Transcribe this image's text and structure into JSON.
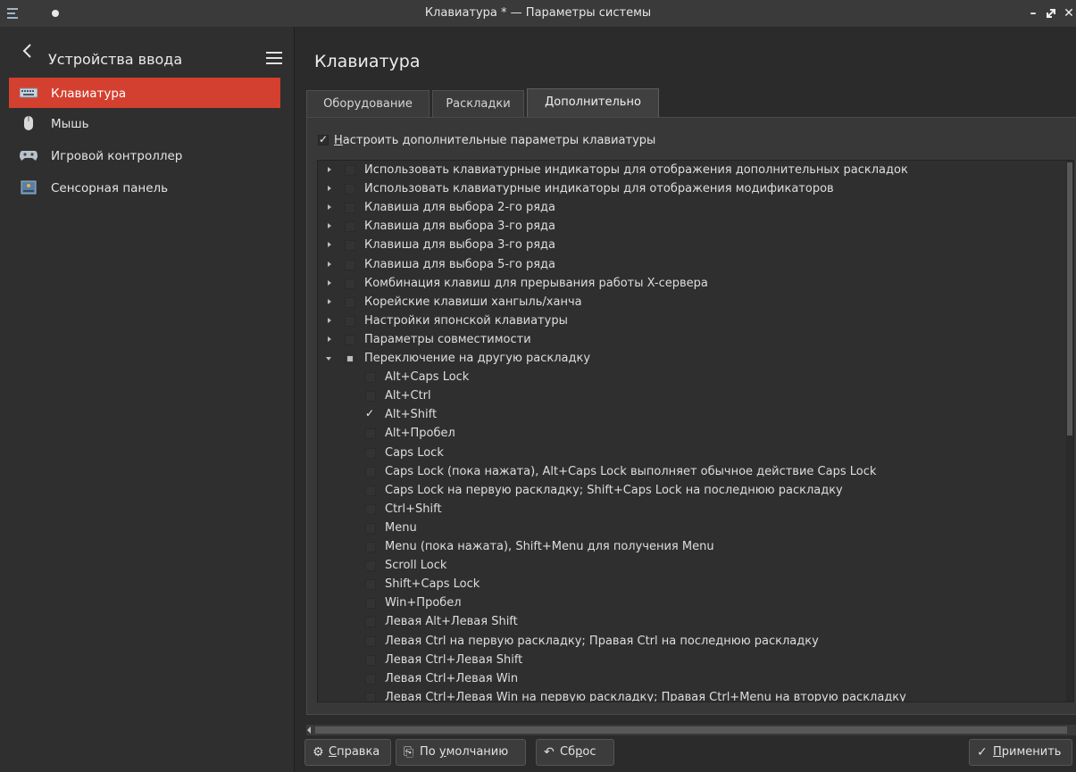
{
  "window": {
    "title": "Клавиатура * — Параметры системы"
  },
  "sidebar": {
    "title": "Устройства ввода",
    "items": [
      {
        "label": "Клавиатура",
        "icon": "keyboard-icon",
        "active": true
      },
      {
        "label": "Мышь",
        "icon": "mouse-icon",
        "active": false
      },
      {
        "label": "Игровой контроллер",
        "icon": "gamepad-icon",
        "active": false
      },
      {
        "label": "Сенсорная панель",
        "icon": "touchpad-icon",
        "active": false
      }
    ]
  },
  "main": {
    "title": "Клавиатура",
    "tabs": [
      {
        "label": "Оборудование",
        "active": false
      },
      {
        "label": "Раскладки",
        "active": false
      },
      {
        "label": "Дополнительно",
        "active": true
      }
    ],
    "advanced": {
      "configure_label_mnemonic": "Н",
      "configure_label_rest": "астроить дополнительные параметры клавиатуры",
      "configure_checked": true
    },
    "tree_parents": [
      {
        "label": "Использовать клавиатурные индикаторы для отображения дополнительных раскладок"
      },
      {
        "label": "Использовать клавиатурные индикаторы для отображения модификаторов"
      },
      {
        "label": "Клавиша для выбора 2-го ряда"
      },
      {
        "label": "Клавиша для выбора 3-го ряда"
      },
      {
        "label": "Клавиша для выбора 3-го ряда"
      },
      {
        "label": "Клавиша для выбора 5-го ряда"
      },
      {
        "label": "Комбинация клавиш для прерывания работы X-сервера"
      },
      {
        "label": "Корейские клавиши хангыль/ханча"
      },
      {
        "label": "Настройки японской клавиатуры"
      },
      {
        "label": "Параметры совместимости"
      },
      {
        "label": "Переключение на другую раскладку",
        "expanded": true
      }
    ],
    "tree_children": [
      {
        "label": "Alt+Caps Lock",
        "checked": false
      },
      {
        "label": "Alt+Ctrl",
        "checked": false
      },
      {
        "label": "Alt+Shift",
        "checked": true
      },
      {
        "label": "Alt+Пробел",
        "checked": false
      },
      {
        "label": "Caps Lock",
        "checked": false
      },
      {
        "label": "Caps Lock (пока нажата), Alt+Caps Lock выполняет обычное действие Caps Lock",
        "checked": false
      },
      {
        "label": "Caps Lock на первую раскладку; Shift+Caps Lock на последнюю раскладку",
        "checked": false
      },
      {
        "label": "Ctrl+Shift",
        "checked": false
      },
      {
        "label": "Menu",
        "checked": false
      },
      {
        "label": "Menu (пока нажата), Shift+Menu для получения Menu",
        "checked": false
      },
      {
        "label": "Scroll Lock",
        "checked": false
      },
      {
        "label": "Shift+Caps Lock",
        "checked": false
      },
      {
        "label": "Win+Пробел",
        "checked": false
      },
      {
        "label": "Левая Alt+Левая Shift",
        "checked": false
      },
      {
        "label": "Левая Ctrl на первую раскладку; Правая Ctrl на последнюю раскладку",
        "checked": false
      },
      {
        "label": "Левая Ctrl+Левая Shift",
        "checked": false
      },
      {
        "label": "Левая Ctrl+Левая Win",
        "checked": false
      },
      {
        "label": "Левая Ctrl+Левая Win на первую раскладку; Правая Ctrl+Menu на вторую раскладку",
        "checked": false
      }
    ]
  },
  "buttons": {
    "help": {
      "mnemonic": "С",
      "rest": "правка",
      "icon": "help-icon"
    },
    "defaults": {
      "prefix": "По ",
      "mnemonic": "у",
      "rest": "молчанию",
      "icon": "defaults-icon"
    },
    "reset": {
      "prefix": "Сб",
      "mnemonic": "р",
      "rest": "ос",
      "icon": "undo-icon"
    },
    "apply": {
      "mnemonic": "П",
      "rest": "рименить",
      "icon": "checkmark-icon"
    }
  }
}
